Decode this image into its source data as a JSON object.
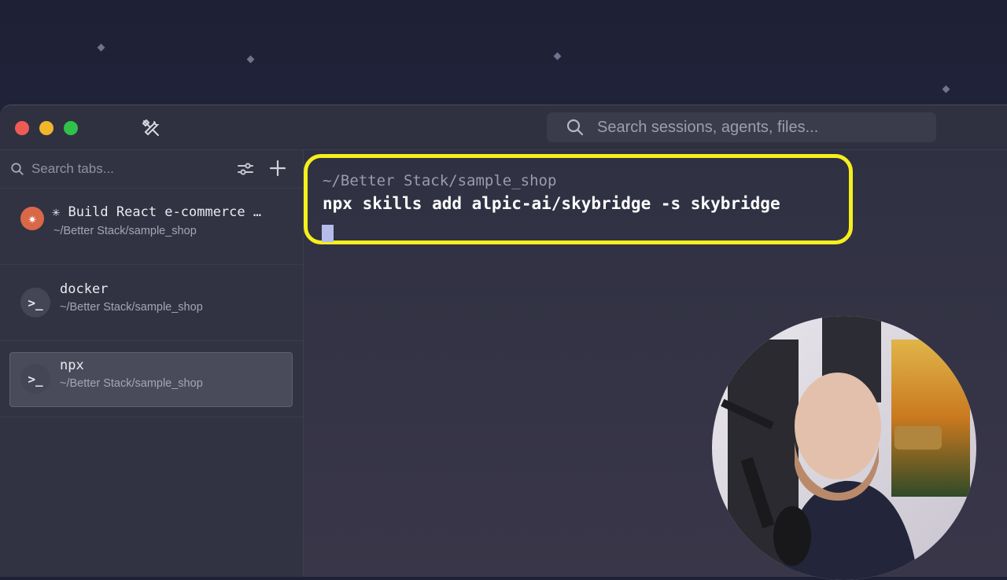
{
  "toolbar": {
    "sidebar_toggle_icon": "sidebar-icon",
    "tools_icon": "tools-icon",
    "search_placeholder": "Search sessions, agents, files..."
  },
  "sidebar": {
    "search_placeholder": "Search tabs...",
    "tabs": [
      {
        "title": "✳ Build React e-commerce …",
        "path": "~/Better Stack/sample_shop",
        "icon": "claude-icon",
        "active": false
      },
      {
        "title": "docker",
        "path": "~/Better Stack/sample_shop",
        "icon": "terminal-icon",
        "active": false
      },
      {
        "title": "npx",
        "path": "~/Better Stack/sample_shop",
        "icon": "terminal-icon",
        "active": true
      }
    ]
  },
  "terminal": {
    "cwd": "~/Better Stack/sample_shop",
    "command": "npx skills add alpic-ai/skybridge -s skybridge"
  },
  "colors": {
    "highlight_border": "#f5ef1d",
    "close": "#ee5b54",
    "minimize": "#f0b62c",
    "zoom": "#2fc14a"
  }
}
